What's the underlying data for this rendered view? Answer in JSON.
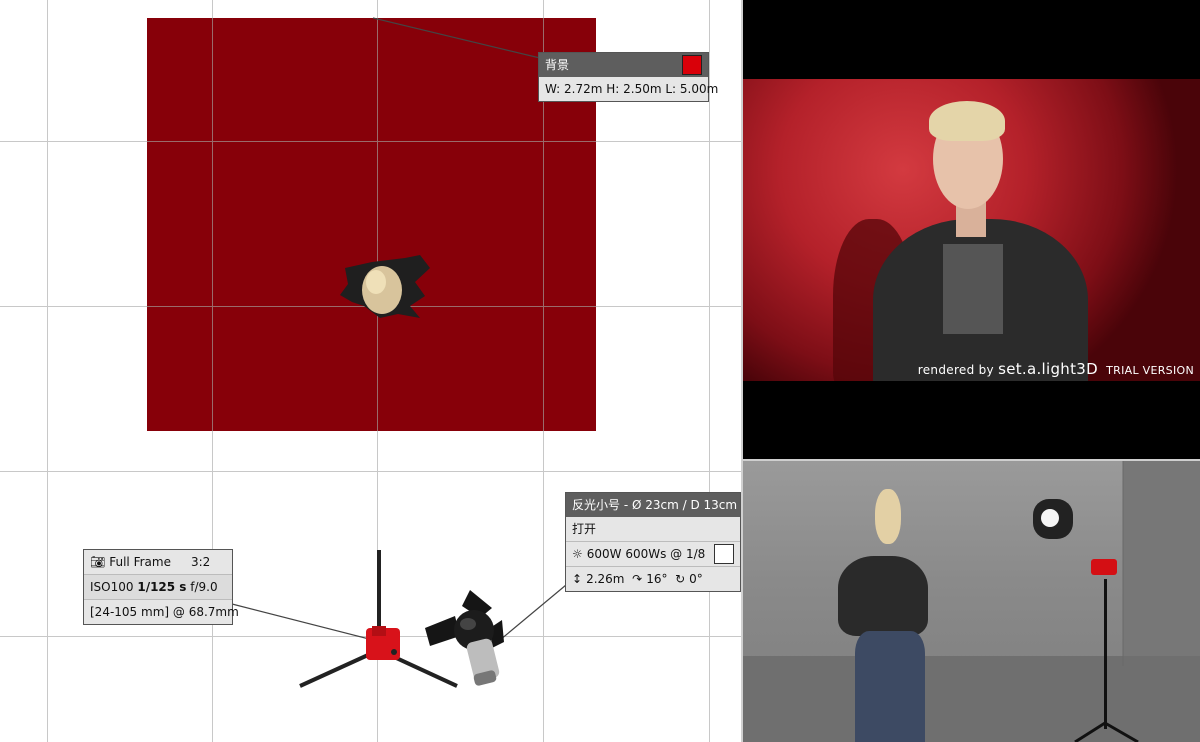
{
  "floor_plan": {
    "backdrop_color": "#870009",
    "background_tooltip": {
      "title": "背景",
      "color_swatch": "#d90009",
      "dimensions": "W: 2.72m H: 2.50m L: 5.00m"
    },
    "camera_tooltip": {
      "icon": "camera-icon",
      "sensor": "Full Frame",
      "aspect": "3:2",
      "iso": "ISO100",
      "shutter": "1/125 s",
      "aperture": "f/9.0",
      "lens": "[24-105 mm] @ 68.7mm"
    },
    "light_tooltip": {
      "title": "反光小号 - Ø 23cm / D 13cm",
      "state": "打开",
      "power_icon": "light-power-icon",
      "power": "600W 600Ws @ 1/8",
      "light_color_swatch": "#ffffff",
      "height_icon": "height-icon",
      "height": "2.26m",
      "tilt_icon": "tilt-icon",
      "tilt": "16°",
      "rotation_icon": "rotation-icon",
      "rotation": "0°"
    }
  },
  "render_view": {
    "watermark_prefix": "rendered by",
    "watermark_brand": "set.a.light",
    "watermark_brand_suffix": "3D",
    "watermark_trial": "TRIAL VERSION"
  }
}
